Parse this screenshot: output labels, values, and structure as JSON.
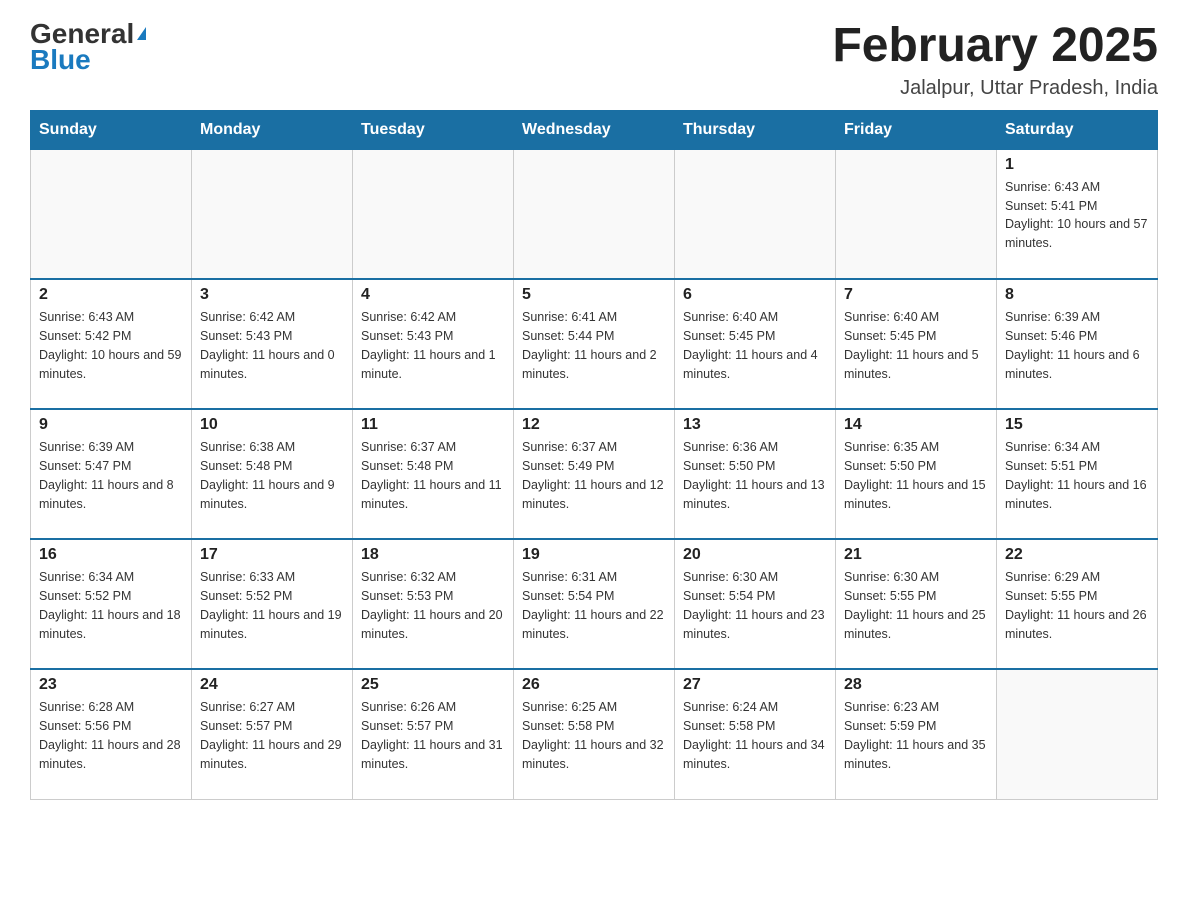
{
  "header": {
    "logo_general": "General",
    "logo_blue": "Blue",
    "title": "February 2025",
    "subtitle": "Jalalpur, Uttar Pradesh, India"
  },
  "weekdays": [
    "Sunday",
    "Monday",
    "Tuesday",
    "Wednesday",
    "Thursday",
    "Friday",
    "Saturday"
  ],
  "weeks": [
    [
      {
        "day": "",
        "info": ""
      },
      {
        "day": "",
        "info": ""
      },
      {
        "day": "",
        "info": ""
      },
      {
        "day": "",
        "info": ""
      },
      {
        "day": "",
        "info": ""
      },
      {
        "day": "",
        "info": ""
      },
      {
        "day": "1",
        "info": "Sunrise: 6:43 AM\nSunset: 5:41 PM\nDaylight: 10 hours and 57 minutes."
      }
    ],
    [
      {
        "day": "2",
        "info": "Sunrise: 6:43 AM\nSunset: 5:42 PM\nDaylight: 10 hours and 59 minutes."
      },
      {
        "day": "3",
        "info": "Sunrise: 6:42 AM\nSunset: 5:43 PM\nDaylight: 11 hours and 0 minutes."
      },
      {
        "day": "4",
        "info": "Sunrise: 6:42 AM\nSunset: 5:43 PM\nDaylight: 11 hours and 1 minute."
      },
      {
        "day": "5",
        "info": "Sunrise: 6:41 AM\nSunset: 5:44 PM\nDaylight: 11 hours and 2 minutes."
      },
      {
        "day": "6",
        "info": "Sunrise: 6:40 AM\nSunset: 5:45 PM\nDaylight: 11 hours and 4 minutes."
      },
      {
        "day": "7",
        "info": "Sunrise: 6:40 AM\nSunset: 5:45 PM\nDaylight: 11 hours and 5 minutes."
      },
      {
        "day": "8",
        "info": "Sunrise: 6:39 AM\nSunset: 5:46 PM\nDaylight: 11 hours and 6 minutes."
      }
    ],
    [
      {
        "day": "9",
        "info": "Sunrise: 6:39 AM\nSunset: 5:47 PM\nDaylight: 11 hours and 8 minutes."
      },
      {
        "day": "10",
        "info": "Sunrise: 6:38 AM\nSunset: 5:48 PM\nDaylight: 11 hours and 9 minutes."
      },
      {
        "day": "11",
        "info": "Sunrise: 6:37 AM\nSunset: 5:48 PM\nDaylight: 11 hours and 11 minutes."
      },
      {
        "day": "12",
        "info": "Sunrise: 6:37 AM\nSunset: 5:49 PM\nDaylight: 11 hours and 12 minutes."
      },
      {
        "day": "13",
        "info": "Sunrise: 6:36 AM\nSunset: 5:50 PM\nDaylight: 11 hours and 13 minutes."
      },
      {
        "day": "14",
        "info": "Sunrise: 6:35 AM\nSunset: 5:50 PM\nDaylight: 11 hours and 15 minutes."
      },
      {
        "day": "15",
        "info": "Sunrise: 6:34 AM\nSunset: 5:51 PM\nDaylight: 11 hours and 16 minutes."
      }
    ],
    [
      {
        "day": "16",
        "info": "Sunrise: 6:34 AM\nSunset: 5:52 PM\nDaylight: 11 hours and 18 minutes."
      },
      {
        "day": "17",
        "info": "Sunrise: 6:33 AM\nSunset: 5:52 PM\nDaylight: 11 hours and 19 minutes."
      },
      {
        "day": "18",
        "info": "Sunrise: 6:32 AM\nSunset: 5:53 PM\nDaylight: 11 hours and 20 minutes."
      },
      {
        "day": "19",
        "info": "Sunrise: 6:31 AM\nSunset: 5:54 PM\nDaylight: 11 hours and 22 minutes."
      },
      {
        "day": "20",
        "info": "Sunrise: 6:30 AM\nSunset: 5:54 PM\nDaylight: 11 hours and 23 minutes."
      },
      {
        "day": "21",
        "info": "Sunrise: 6:30 AM\nSunset: 5:55 PM\nDaylight: 11 hours and 25 minutes."
      },
      {
        "day": "22",
        "info": "Sunrise: 6:29 AM\nSunset: 5:55 PM\nDaylight: 11 hours and 26 minutes."
      }
    ],
    [
      {
        "day": "23",
        "info": "Sunrise: 6:28 AM\nSunset: 5:56 PM\nDaylight: 11 hours and 28 minutes."
      },
      {
        "day": "24",
        "info": "Sunrise: 6:27 AM\nSunset: 5:57 PM\nDaylight: 11 hours and 29 minutes."
      },
      {
        "day": "25",
        "info": "Sunrise: 6:26 AM\nSunset: 5:57 PM\nDaylight: 11 hours and 31 minutes."
      },
      {
        "day": "26",
        "info": "Sunrise: 6:25 AM\nSunset: 5:58 PM\nDaylight: 11 hours and 32 minutes."
      },
      {
        "day": "27",
        "info": "Sunrise: 6:24 AM\nSunset: 5:58 PM\nDaylight: 11 hours and 34 minutes."
      },
      {
        "day": "28",
        "info": "Sunrise: 6:23 AM\nSunset: 5:59 PM\nDaylight: 11 hours and 35 minutes."
      },
      {
        "day": "",
        "info": ""
      }
    ]
  ]
}
